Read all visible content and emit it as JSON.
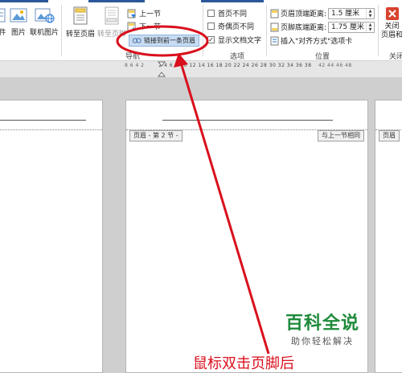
{
  "ribbon": {
    "insert_group": {
      "partial_label": "件",
      "picture_label": "图片",
      "online_picture_label": "联机图片"
    },
    "navigation_group": {
      "goto_header_label": "转至页眉",
      "goto_footer_label": "转至页脚",
      "previous_label": "上一节",
      "next_label": "下一节",
      "link_to_previous_label": "链接到前一条页眉",
      "group_label": "导航"
    },
    "options_group": {
      "different_first_page_label": "首页不同",
      "different_first_page_checked": false,
      "different_odd_even_label": "奇偶页不同",
      "different_odd_even_checked": false,
      "show_document_text_label": "显示文档文字",
      "show_document_text_checked": true,
      "group_label": "选项"
    },
    "position_group": {
      "header_from_top_label": "页眉顶端距离:",
      "header_from_top_value": "1.5 厘米",
      "footer_from_bottom_label": "页脚底端距离:",
      "footer_from_bottom_value": "1.75 厘米",
      "insert_alignment_tab_label": "插入\"对齐方式\"选项卡",
      "group_label": "位置"
    },
    "close_group": {
      "close_label_line1": "关闭",
      "close_label_line2": "页眉和",
      "group_label": "关闭"
    }
  },
  "ruler": {
    "left_ticks": "8  6  4  2",
    "main_ticks": "2  4  6  8  10 12 14 16 18 20 22 24 26 28 30 32 34 36 38",
    "right_ticks": "42 44 46 48"
  },
  "pages": {
    "header_section_tag": "页眉 - 第 2 节 -",
    "same_as_previous_tag": "与上一节相同",
    "right_page_header_tag": "页眉"
  },
  "annotation": {
    "caption": "鼠标双击页脚后",
    "color": "#d90f1c"
  },
  "watermark": {
    "main": "百科全说",
    "sub": "助你轻松解决"
  },
  "colors": {
    "ribbon_accent": "#2b579a",
    "annotation_red": "#d90f1c",
    "watermark_green": "#1f8a3a"
  }
}
